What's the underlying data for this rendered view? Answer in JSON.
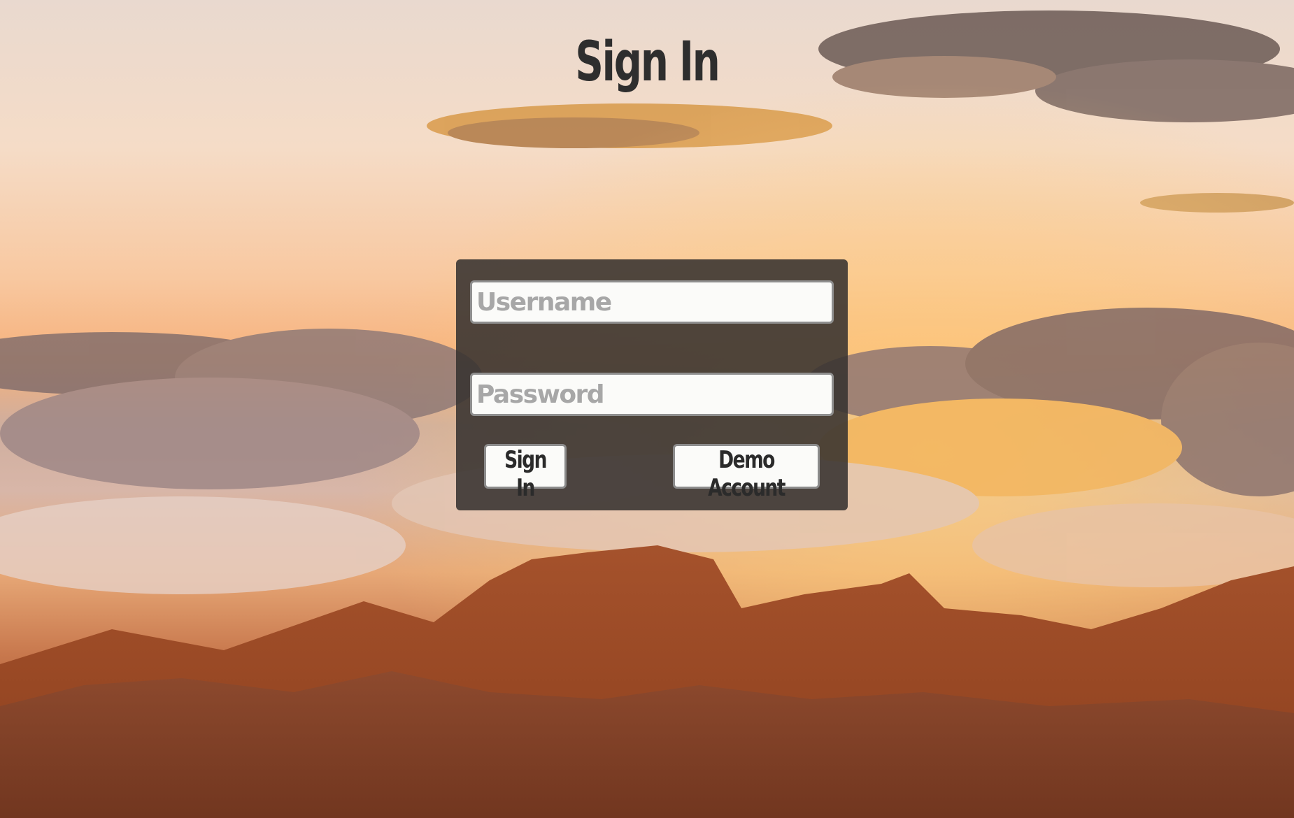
{
  "page": {
    "title": "Sign In"
  },
  "form": {
    "username_placeholder": "Username",
    "username_value": "",
    "password_placeholder": "Password",
    "password_value": "",
    "signin_label": "Sign In",
    "demo_label": "Demo Account"
  },
  "colors": {
    "title_text": "#2e2e2e",
    "panel_bg": "#373230",
    "input_bg": "#fbfbf9",
    "input_border": "#8f8f8f",
    "placeholder_text": "#a7a7a7"
  },
  "background": {
    "image": "sunset-mountains-clouds"
  }
}
